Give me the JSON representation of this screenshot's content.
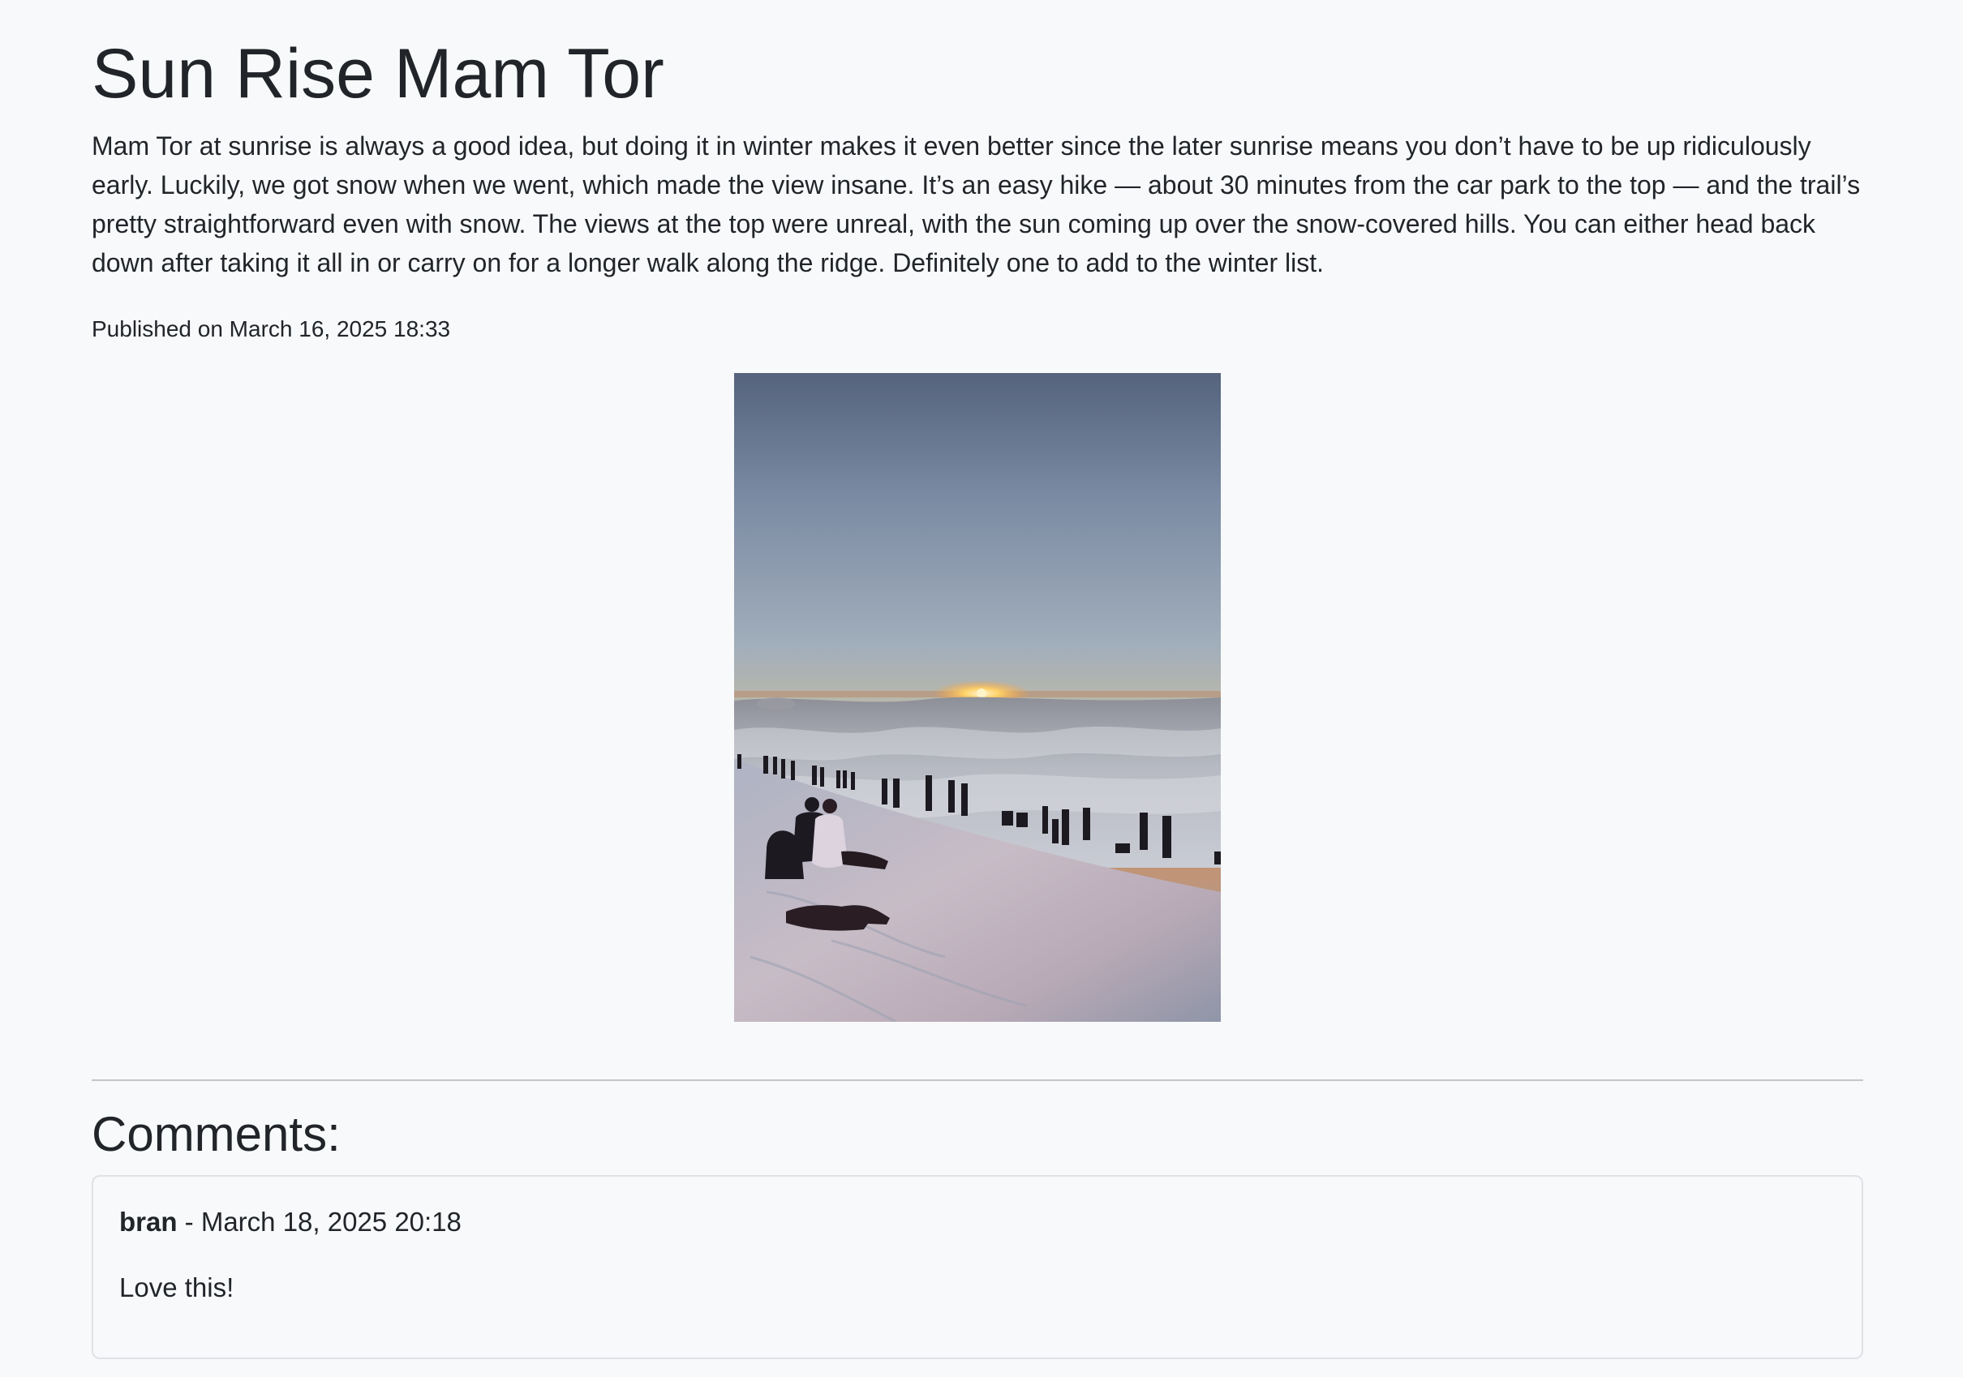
{
  "post": {
    "title": "Sun Rise Mam Tor",
    "body": "Mam Tor at sunrise is always a good idea, but doing it in winter makes it even better since the later sunrise means you don’t have to be up ridiculously early. Luckily, we got snow when we went, which made the view insane. It’s an easy hike — about 30 minutes from the car park to the top — and the trail’s pretty straightforward even with snow. The views at the top were unreal, with the sun coming up over the snow-covered hills. You can either head back down after taking it all in or carry on for a longer walk along the ridge. Definitely one to add to the winter list.",
    "published": "Published on March 16, 2025 18:33"
  },
  "comments": {
    "heading": "Comments:",
    "items": [
      {
        "author": "bran",
        "separator": " - ",
        "date": "March 18, 2025 20:18",
        "text": "Love this!"
      }
    ]
  },
  "colors": {
    "text": "#212529",
    "background": "#f8f9fa",
    "divider": "#c4c6c9",
    "card_border": "#dee2e6"
  }
}
